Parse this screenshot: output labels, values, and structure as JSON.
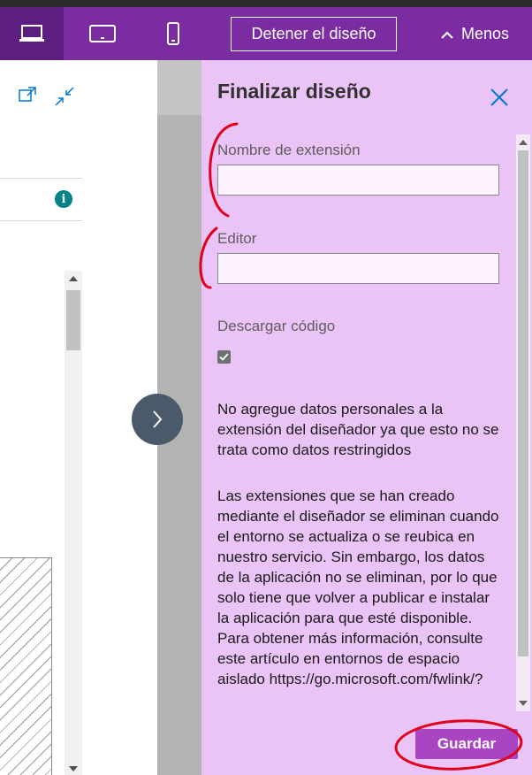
{
  "toolbar": {
    "devices": [
      {
        "name": "desktop-icon",
        "active": true
      },
      {
        "name": "tablet-icon",
        "active": false
      },
      {
        "name": "phone-icon",
        "active": false
      }
    ],
    "stop_design_label": "Detener el diseño",
    "less_label": "Menos"
  },
  "panel": {
    "title": "Finalizar diseño",
    "extension_name": {
      "label": "Nombre de extensión",
      "value": ""
    },
    "publisher": {
      "label": "Editor",
      "value": ""
    },
    "download_code": {
      "label": "Descargar código",
      "checked": true
    },
    "note_personal_data": "No agregue datos personales a la extensión del diseñador ya que esto no se trata como datos restringidos",
    "note_extensions": "Las extensiones que se han creado mediante el diseñador se eliminan cuando el entorno se actualiza o se reubica en nuestro servicio. Sin embargo, los datos de la aplicación no se eliminan, por lo que solo tiene que volver a publicar e instalar la aplicación para que esté disponible. Para obtener más información, consulte este artículo en entornos de espacio aislado https://go.microsoft.com/fwlink/?",
    "save_label": "Guardar"
  },
  "preview": {
    "info_glyph": "i"
  },
  "colors": {
    "toolbar": "#7a2ca0",
    "panel_background": "#eac3f7",
    "save_button": "#a945c2",
    "annotation": "#e0001b"
  }
}
